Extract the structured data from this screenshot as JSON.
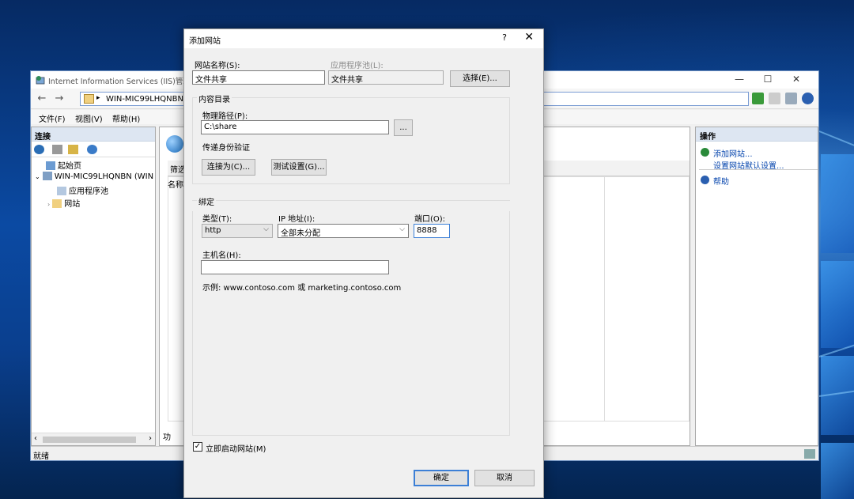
{
  "iis": {
    "title": "Internet Information Services (IIS)管理",
    "path": "WIN-MIC99LHQNBN",
    "menu": [
      "文件(F)",
      "视图(V)",
      "帮助(H)"
    ],
    "connections_header": "连接",
    "tree": [
      "起始页",
      "WIN-MIC99LHQNBN (WIN",
      "应用程序池",
      "网站"
    ],
    "filter_label": "筛选",
    "name_col": "名称",
    "bottom_tab": "功",
    "actions_header": "操作",
    "actions": [
      "添加网站...",
      "设置网站默认设置...",
      "帮助"
    ],
    "status": "就绪"
  },
  "dialog": {
    "title": "添加网站",
    "help": "?",
    "close": "✕",
    "site_name_label": "网站名称(S):",
    "site_name_value": "文件共享",
    "app_pool_label": "应用程序池(L):",
    "app_pool_value": "文件共享",
    "select_button": "选择(E)...",
    "content_dir_title": "内容目录",
    "physical_path_label": "物理路径(P):",
    "physical_path_value": "C:\\share",
    "browse_button": "...",
    "passthrough_label": "传递身份验证",
    "connect_as_button": "连接为(C)...",
    "test_settings_button": "测试设置(G)...",
    "binding_title": "绑定",
    "type_label": "类型(T):",
    "type_value": "http",
    "ip_label": "IP 地址(I):",
    "ip_value": "全部未分配",
    "port_label": "端口(O):",
    "port_value": "8888",
    "hostname_label": "主机名(H):",
    "hostname_value": "",
    "example_text": "示例: www.contoso.com 或 marketing.contoso.com",
    "start_immediately_label": "立即启动网站(M)",
    "start_immediately_checked": true,
    "ok_button": "确定",
    "cancel_button": "取消"
  }
}
